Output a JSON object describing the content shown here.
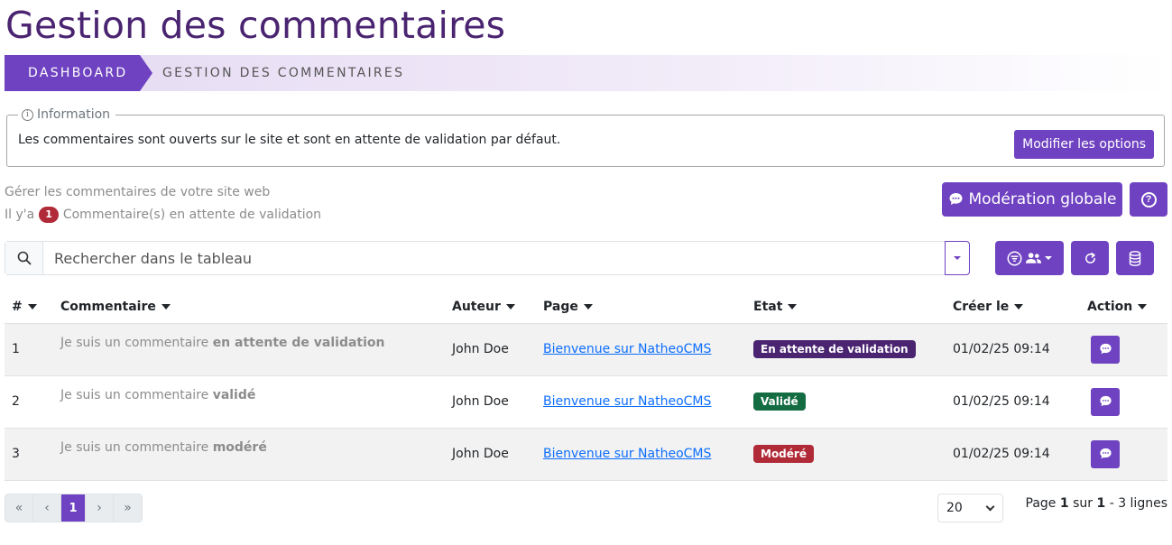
{
  "page": {
    "title": "Gestion des commentaires"
  },
  "breadcrumb": {
    "items": [
      "Dashboard",
      "Gestion des commentaires"
    ]
  },
  "info": {
    "legend": "Information",
    "text": "Les commentaires sont ouverts sur le site et sont en attente de validation par défaut.",
    "button": "Modifier les options"
  },
  "summary": {
    "manage_text": "Gérer les commentaires de votre site web",
    "pending_prefix": "Il y'a",
    "pending_count": "1",
    "pending_suffix": "Commentaire(s) en attente de validation"
  },
  "actions": {
    "moderation_label": "Modération globale",
    "help_symbol": "?"
  },
  "search": {
    "placeholder": "Rechercher dans le tableau"
  },
  "table": {
    "headers": [
      "#",
      "Commentaire",
      "Auteur",
      "Page",
      "Etat",
      "Créer le",
      "Action"
    ],
    "rows": [
      {
        "id": "1",
        "comment_prefix": "Je suis un commentaire",
        "comment_bold": "en attente de validation",
        "author": "John Doe",
        "page": "Bienvenue sur NatheoCMS",
        "state": "En attente de validation",
        "state_color": "#4a2470",
        "created": "01/02/25 09:14"
      },
      {
        "id": "2",
        "comment_prefix": "Je suis un commentaire",
        "comment_bold": "validé",
        "author": "John Doe",
        "page": "Bienvenue sur NatheoCMS",
        "state": "Validé",
        "state_color": "#146c43",
        "created": "01/02/25 09:14"
      },
      {
        "id": "3",
        "comment_prefix": "Je suis un commentaire",
        "comment_bold": "modéré",
        "author": "John Doe",
        "page": "Bienvenue sur NatheoCMS",
        "state": "Modéré",
        "state_color": "#b02a37",
        "created": "01/02/25 09:14"
      }
    ]
  },
  "pagination": {
    "first": "«",
    "prev": "‹",
    "current": "1",
    "next": "›",
    "last": "»"
  },
  "page_size": {
    "value": "20"
  },
  "page_info": {
    "prefix": "Page",
    "current": "1",
    "middle": "sur",
    "total": "1",
    "suffix": "- 3 lignes"
  },
  "colors": {
    "primary": "#6f42c1",
    "title": "#4a2470",
    "danger": "#b02a37",
    "success": "#146c43"
  }
}
